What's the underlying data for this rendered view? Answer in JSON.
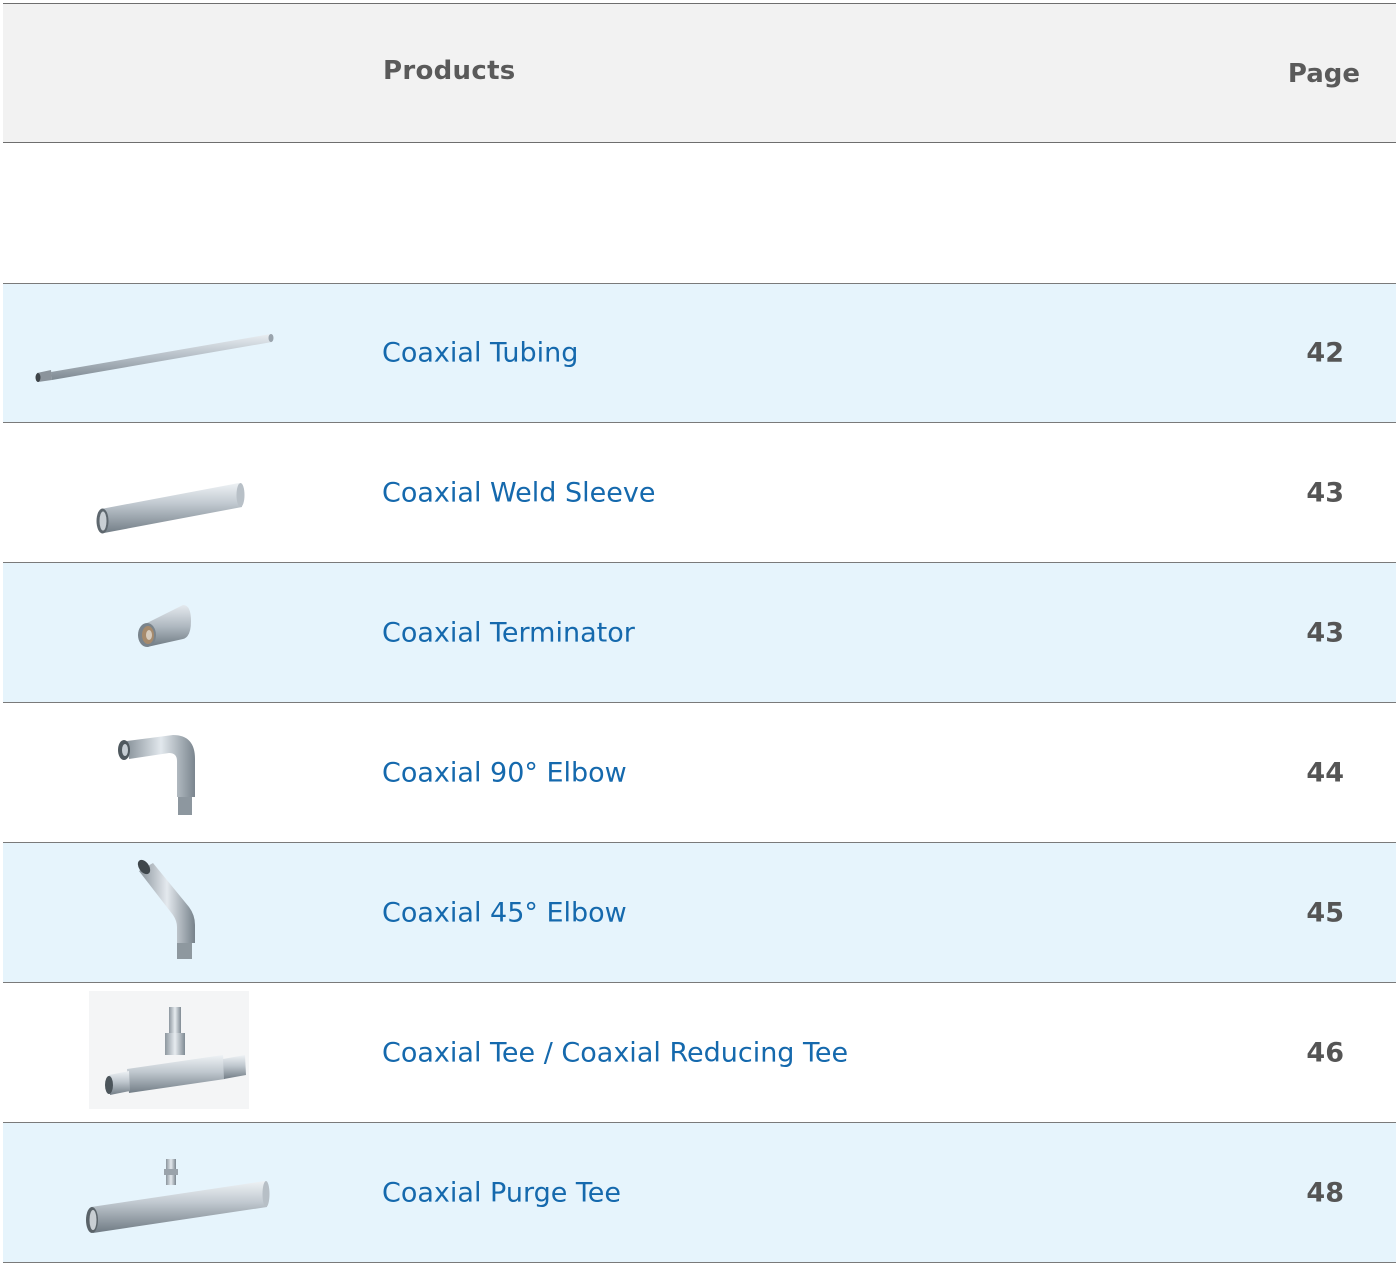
{
  "header": {
    "products_label": "Products",
    "page_label": "Page"
  },
  "rows": [
    {
      "name": "Coaxial Tubing",
      "page": "42",
      "icon": "coaxial-tubing-icon"
    },
    {
      "name": "Coaxial Weld Sleeve",
      "page": "43",
      "icon": "coaxial-weld-sleeve-icon"
    },
    {
      "name": "Coaxial Terminator",
      "page": "43",
      "icon": "coaxial-terminator-icon"
    },
    {
      "name": "Coaxial 90° Elbow",
      "page": "44",
      "icon": "coaxial-90-elbow-icon"
    },
    {
      "name": "Coaxial 45° Elbow",
      "page": "45",
      "icon": "coaxial-45-elbow-icon"
    },
    {
      "name": "Coaxial Tee / Coaxial Reducing Tee",
      "page": "46",
      "icon": "coaxial-tee-icon"
    },
    {
      "name": "Coaxial Purge Tee",
      "page": "48",
      "icon": "coaxial-purge-tee-icon"
    }
  ],
  "colors": {
    "header_bg": "#f2f2f2",
    "row_shade": "#e6f4fc",
    "link_blue": "#1569ad",
    "page_gray": "#555555"
  }
}
